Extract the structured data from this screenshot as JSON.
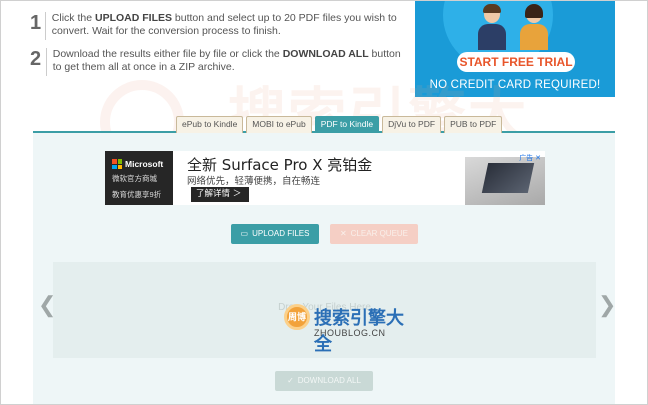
{
  "steps": [
    {
      "number": "1",
      "text_before": "Click the ",
      "bold": "UPLOAD FILES",
      "text_after": " button and select up to 20 PDF files you wish to convert. Wait for the conversion process to finish."
    },
    {
      "number": "2",
      "text_before": "Download the results either file by file or click the ",
      "bold": "DOWNLOAD ALL",
      "text_after": " button to get them all at once in a ZIP archive."
    }
  ],
  "promo": {
    "cta": "START FREE TRIAL",
    "note": "NO CREDIT CARD REQUIRED!",
    "bg_color": "#1a9bd7",
    "cta_color": "#e8552a"
  },
  "tabs": [
    {
      "label": "ePub to Kindle",
      "active": false
    },
    {
      "label": "MOBI to ePub",
      "active": false
    },
    {
      "label": "PDF to Kindle",
      "active": true
    },
    {
      "label": "DjVu to PDF",
      "active": false
    },
    {
      "label": "PUB to PDF",
      "active": false
    }
  ],
  "ad": {
    "brand": "Microsoft",
    "store": "微软官方商城",
    "discount": "教育优惠享9折",
    "title": "全新 Surface Pro X 亮铂金",
    "subtitle": "网络优先，轻薄便携，自在畅连",
    "button": "了解详情 ＞",
    "badge": "广告 ✕"
  },
  "buttons": {
    "upload": "UPLOAD FILES",
    "clear": "CLEAR QUEUE",
    "download_all": "DOWNLOAD ALL"
  },
  "dropzone": {
    "text": "Drop Your Files Here"
  },
  "watermark": {
    "cn": "搜索引擎大全",
    "en": "ZHOUBLOG.CN",
    "logo_text": "周博"
  },
  "colors": {
    "accent": "#3b9ea6",
    "panel_bg": "#eef6f7"
  }
}
